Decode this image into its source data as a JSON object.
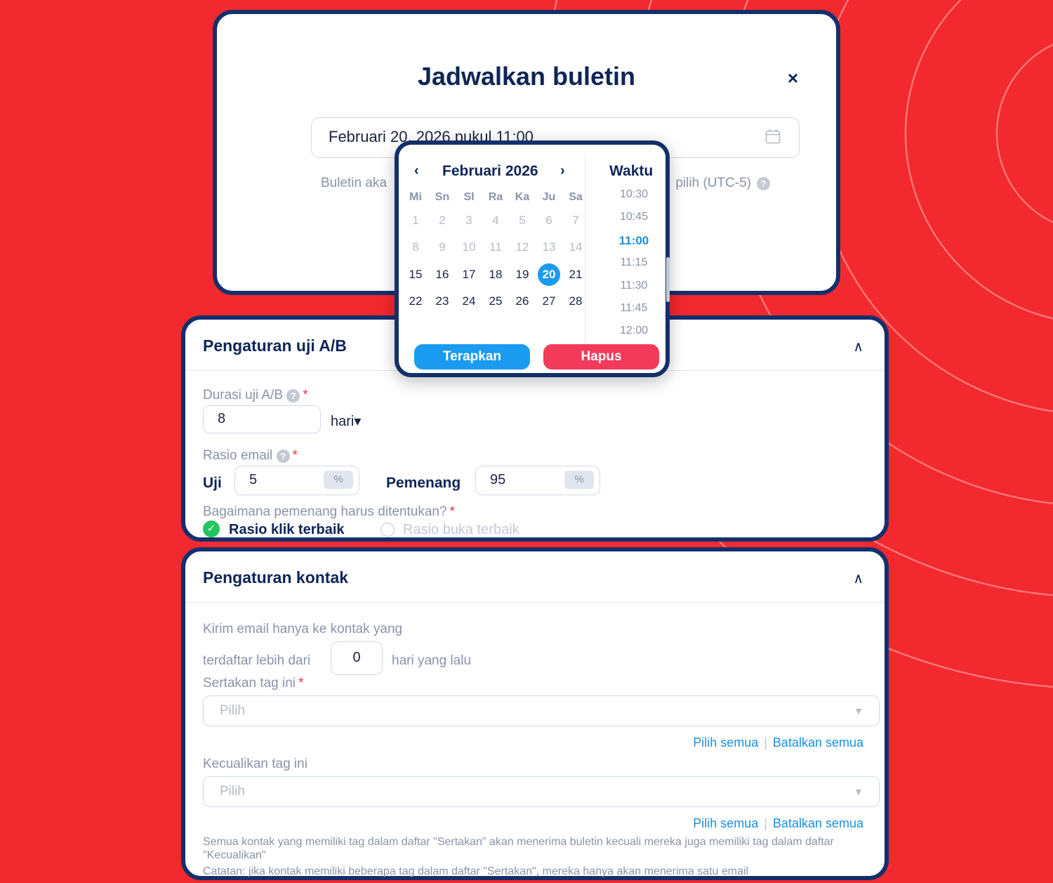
{
  "modal": {
    "title": "Jadwalkan buletin",
    "close": "×",
    "date_value": "Februari 20, 2026 pukul 11:00",
    "tz_note_left": "Buletin aka",
    "tz_note_right": "pilih (UTC-5)",
    "help": "?"
  },
  "picker": {
    "prev": "‹",
    "next": "›",
    "month": "Februari 2026",
    "weekdays": [
      "Mi",
      "Sn",
      "Sl",
      "Ra",
      "Ka",
      "Ju",
      "Sa"
    ],
    "weeks": [
      [
        "1",
        "2",
        "3",
        "4",
        "5",
        "6",
        "7"
      ],
      [
        "8",
        "9",
        "10",
        "11",
        "12",
        "13",
        "14"
      ],
      [
        "15",
        "16",
        "17",
        "18",
        "19",
        "20",
        "21"
      ],
      [
        "22",
        "23",
        "24",
        "25",
        "26",
        "27",
        "28"
      ]
    ],
    "selected_day": "20",
    "time_title": "Waktu",
    "times": [
      "10:30",
      "10:45",
      "11:00",
      "11:15",
      "11:30",
      "11:45",
      "12:00"
    ],
    "selected_time": "11:00",
    "apply": "Terapkan",
    "clear": "Hapus"
  },
  "ab": {
    "title": "Pengaturan uji A/B",
    "chevron": "∧",
    "duration_label": "Durasi uji A/B",
    "duration_value": "8",
    "duration_unit": "hari▾",
    "ratio_label": "Rasio email",
    "test_label": "Uji",
    "test_value": "5",
    "winner_label": "Pemenang",
    "winner_value": "95",
    "percent": "%",
    "winner_question": "Bagaimana pemenang harus ditentukan?",
    "option_click": "Rasio klik terbaik",
    "option_open": "Rasio buka terbaik",
    "check": "✓",
    "required": "*"
  },
  "contacts": {
    "title": "Pengaturan kontak",
    "chevron": "∧",
    "send_only": "Kirim email hanya ke kontak yang",
    "registered_prefix": "terdaftar lebih dari",
    "days_value": "0",
    "registered_suffix": "hari yang lalu",
    "include_label": "Sertakan tag ini",
    "include_placeholder": "Pilih",
    "exclude_label": "Kecualikan tag ini",
    "exclude_placeholder": "Pilih",
    "select_all": "Pilih semua",
    "deselect_all": "Batalkan semua",
    "divider": "|",
    "caret": "▼",
    "note1": "Semua kontak yang memiliki tag dalam daftar \"Sertakan\" akan menerima buletin kecuali mereka juga memiliki tag dalam daftar \"Kecualikan\"",
    "note2": "Catatan: jika kontak memiliki beberapa tag dalam daftar \"Sertakan\", mereka hanya akan menerima satu email"
  },
  "colors": {
    "background": "#f2292e",
    "frame": "#14306b",
    "accent": "#1a9bf0",
    "danger": "#f23b5a",
    "success": "#22c55e"
  }
}
